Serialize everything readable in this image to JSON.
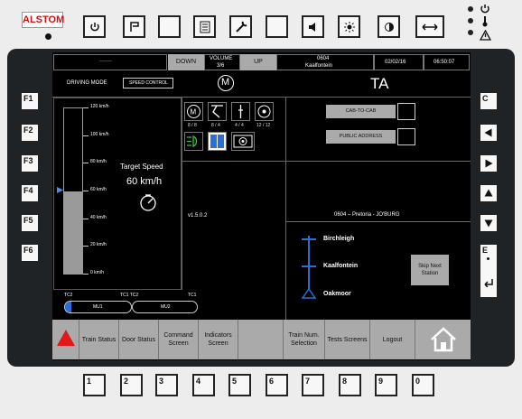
{
  "brand": {
    "name": "ALSTOM"
  },
  "header": {
    "blank": "——",
    "down": "DOWN",
    "volume_label": "VOLUME",
    "volume_value": "3/6",
    "up": "UP",
    "train_no": "0604",
    "station": "Kaalfontein",
    "date": "02/02/16",
    "time": "06:50:07"
  },
  "mode": {
    "label": "DRIVING MODE",
    "value": "SPEED CONTROL",
    "indicator": "M",
    "ta": "TA"
  },
  "speed": {
    "ticks": [
      "120 km/h",
      "100 km/h",
      "80 km/h",
      "60 km/h",
      "40 km/h",
      "20 km/h",
      "0 km/h"
    ],
    "target_label": "Target Speed",
    "target_value": "60 km/h",
    "current_fraction": 0.5
  },
  "status_icons": {
    "counts": [
      "8 / 8",
      "8 / 4",
      "4 / 4",
      "12 / 12"
    ]
  },
  "comm": {
    "cab_to_cab": "CAB-TO-CAB",
    "public_address": "PUBLIC ADDRESS"
  },
  "version": "v1.5.0.2",
  "route": {
    "title": "0604 – Pretoria - JO'BURG",
    "stations": [
      "Birchleigh",
      "Kaalfontein",
      "Oakmoor"
    ],
    "skip_button": "Skip Next Station"
  },
  "coupling": {
    "tc2": "TC2",
    "tc1_tc2": "TC1  TC2",
    "tc1": "TC1",
    "mu1": "MU1",
    "mu2": "MU2"
  },
  "bottom_menu": [
    "Train Status",
    "Door Status",
    "Command Screen",
    "Indicators Screen",
    "",
    "Train Num. Selection",
    "Tests Screens",
    "Logout"
  ],
  "left_keys": [
    "F1",
    "F2",
    "F3",
    "F4",
    "F5",
    "F6"
  ],
  "right_keys": [
    "C",
    "",
    "",
    "",
    "",
    "E"
  ],
  "bottom_keys": [
    "1",
    "2",
    "3",
    "4",
    "5",
    "6",
    "7",
    "8",
    "9",
    "0"
  ],
  "colors": {
    "alarm_red": "#e01818",
    "accent_blue": "#2a6fd6",
    "soft_key_gray": "#aaaaaa",
    "screen_bg": "#000000"
  }
}
